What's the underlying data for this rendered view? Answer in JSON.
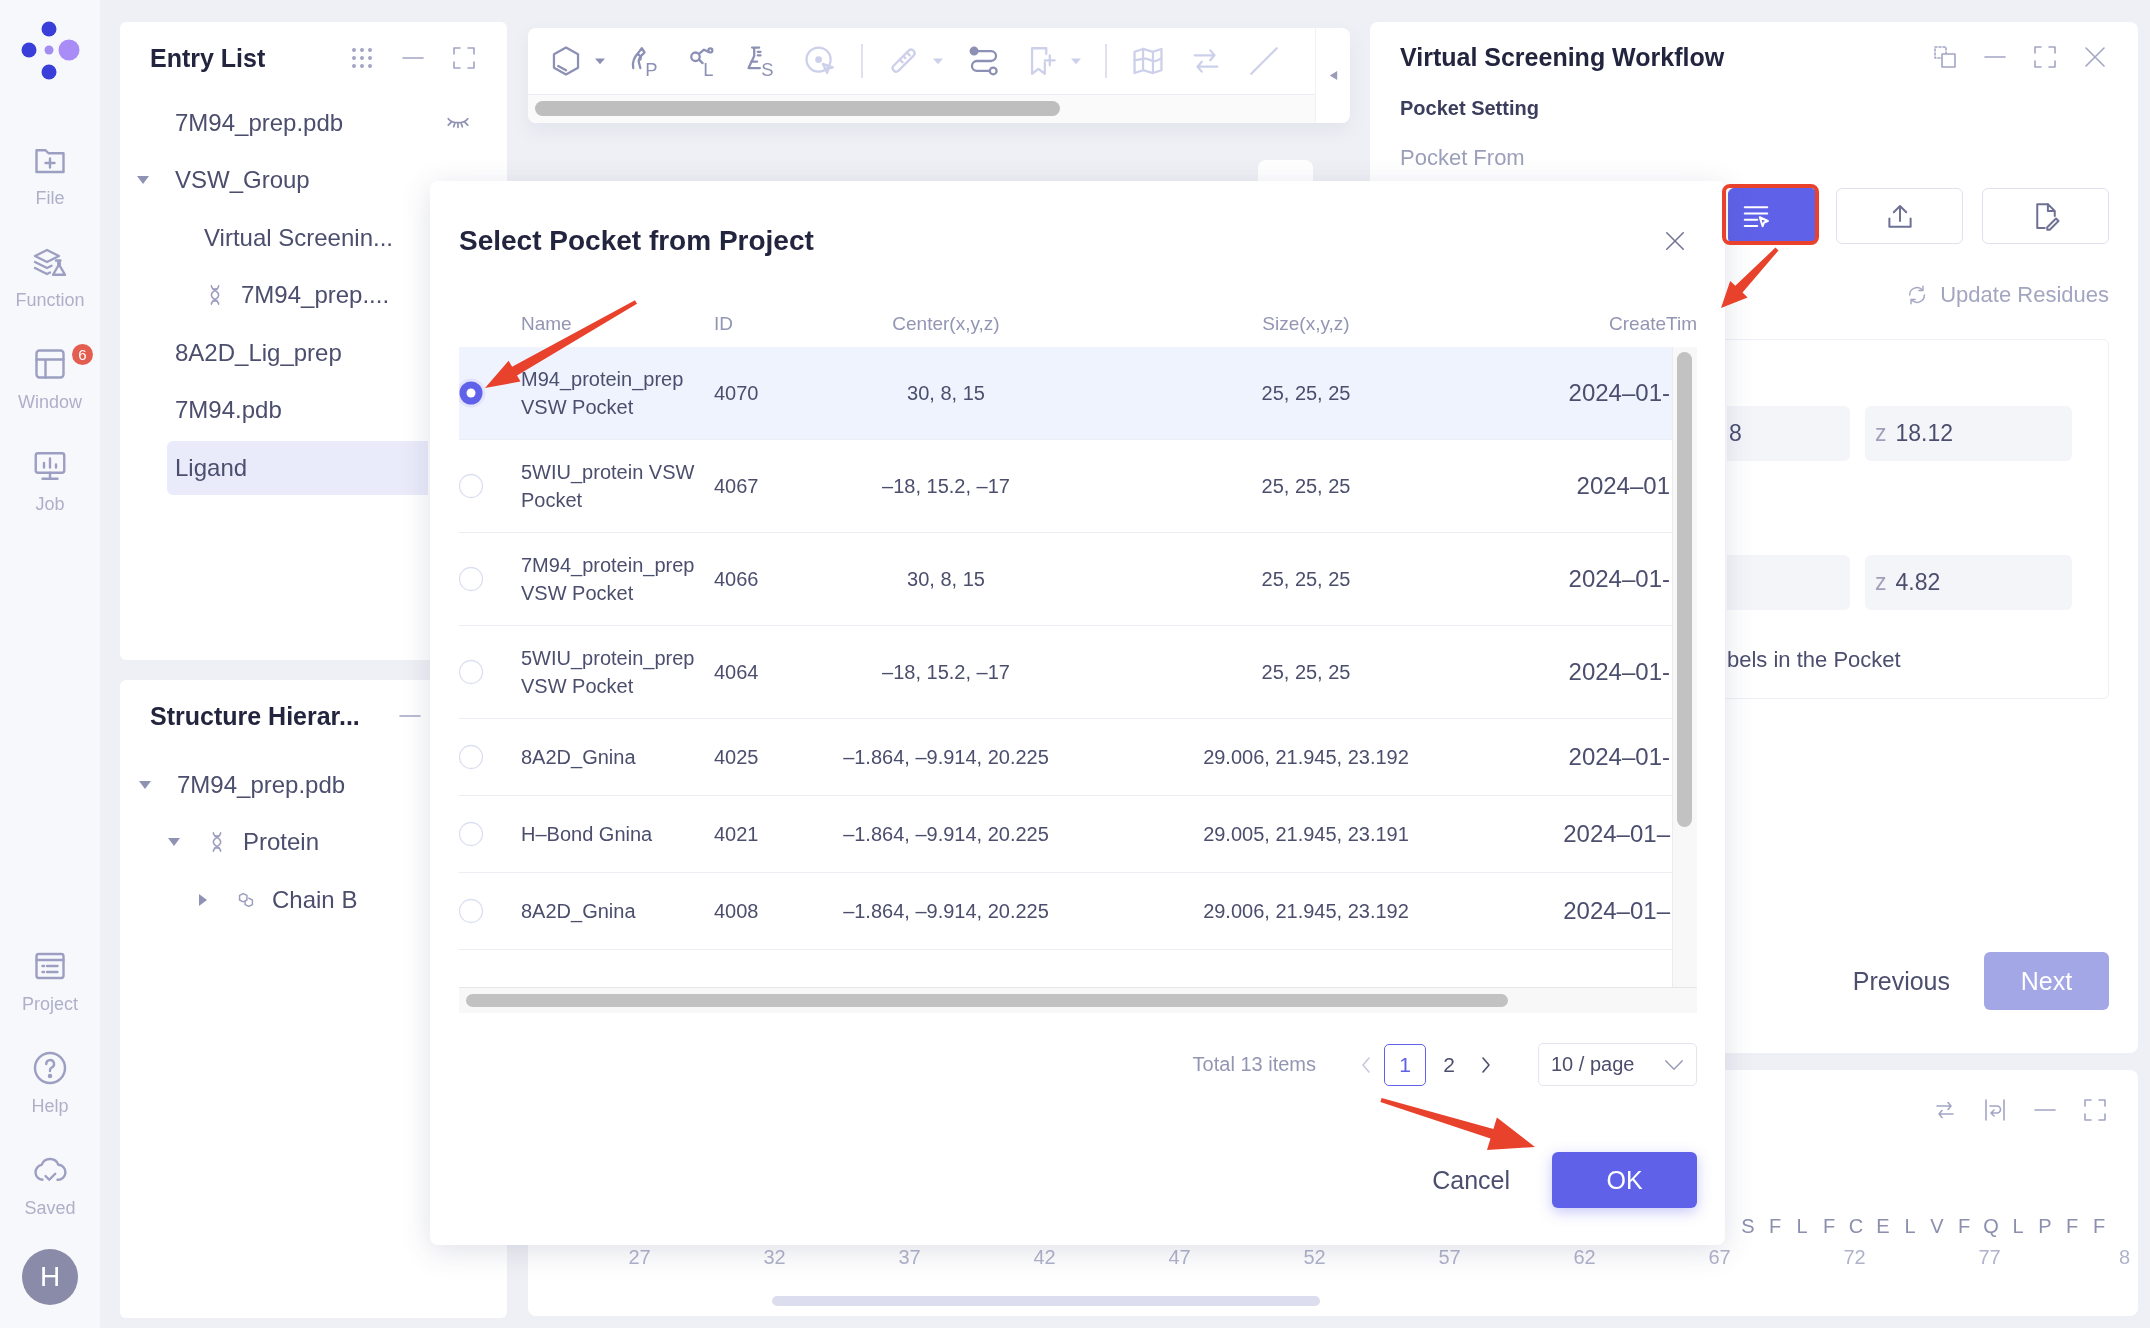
{
  "sidebar": {
    "top_items": [
      {
        "label": "File",
        "kind": "file"
      },
      {
        "label": "Function",
        "kind": "function"
      },
      {
        "label": "Window",
        "kind": "window",
        "badge": "6"
      },
      {
        "label": "Job",
        "kind": "job"
      }
    ],
    "bottom_items": [
      {
        "label": "Project",
        "kind": "project"
      },
      {
        "label": "Help",
        "kind": "help"
      },
      {
        "label": "Saved",
        "kind": "saved"
      }
    ],
    "avatar": {
      "initial": "H"
    }
  },
  "entry_list": {
    "title": "Entry List",
    "items": [
      {
        "label": "7M94_prep.pdb",
        "selected": false,
        "hidden": true
      },
      {
        "label": "VSW_Group",
        "selected": false,
        "expanded": true,
        "children": [
          {
            "label": "Virtual Screenin...",
            "selected": false
          },
          {
            "label": "7M94_prep....",
            "selected": false,
            "kind": "protein"
          }
        ]
      },
      {
        "label": "8A2D_Lig_prep",
        "selected": false
      },
      {
        "label": "7M94.pdb",
        "selected": false
      },
      {
        "label": "Ligand",
        "selected": true
      }
    ]
  },
  "structure_hierarchy": {
    "title": "Structure Hierar...",
    "items": [
      {
        "label": "7M94_prep.pdb",
        "expanded": true,
        "children": [
          {
            "label": "Protein",
            "kind": "protein",
            "expanded": true,
            "children": [
              {
                "label": "Chain B",
                "kind": "chain",
                "expanded": false
              }
            ]
          }
        ]
      }
    ]
  },
  "toolbar": {
    "tools": [
      {
        "kind": "structure",
        "dropdown": true,
        "disabled": false
      },
      {
        "kind": "protein",
        "letter": "P",
        "disabled": false
      },
      {
        "kind": "ligand",
        "letter": "L",
        "disabled": false
      },
      {
        "kind": "lab",
        "letter": "S",
        "disabled": false
      },
      {
        "kind": "pick",
        "disabled": true
      },
      {
        "kind": "separator"
      },
      {
        "kind": "measure",
        "dropdown": true,
        "disabled": true
      },
      {
        "kind": "link",
        "disabled": false
      },
      {
        "kind": "bookmark",
        "dropdown": true,
        "disabled": true
      },
      {
        "kind": "separator"
      },
      {
        "kind": "map",
        "disabled": true
      },
      {
        "kind": "swap",
        "disabled": true
      },
      {
        "kind": "line",
        "disabled": true
      }
    ]
  },
  "workflow": {
    "title": "Virtual Screening Workflow",
    "section": "Pocket Setting",
    "pocket_from": {
      "label": "Pocket From",
      "options": [
        {
          "kind": "list",
          "selected": true
        },
        {
          "kind": "upload",
          "selected": false
        },
        {
          "kind": "edit",
          "selected": false
        }
      ]
    },
    "update_residues": {
      "label": "Update Residues",
      "disabled": true
    },
    "coordinate_rows": [
      {
        "fields": [
          {
            "kind": "coordinate",
            "value": "8"
          },
          {
            "kind": "coordinate",
            "axis": "z",
            "value": "18.12"
          }
        ]
      },
      {
        "fields": [
          {
            "kind": "coordinate"
          },
          {
            "kind": "coordinate",
            "axis": "z",
            "value": "4.82"
          }
        ]
      }
    ],
    "note": "bels in the Pocket",
    "buttons": [
      {
        "label": "Previous",
        "kind": "text",
        "disabled": false
      },
      {
        "label": "Next",
        "kind": "primary",
        "disabled": true
      }
    ]
  },
  "sequence_viewer": {
    "residues": [
      "S",
      "F",
      "L",
      "F",
      "C",
      "E",
      "L",
      "V",
      "F",
      "Q",
      "L",
      "P",
      "F",
      "F"
    ],
    "ruler": [
      "27",
      "32",
      "37",
      "42",
      "47",
      "52",
      "57",
      "62",
      "67",
      "72",
      "77",
      "8"
    ]
  },
  "dialog": {
    "title": "Select Pocket from Project",
    "table": {
      "columns": [
        "Name",
        "ID",
        "Center(x,y,z)",
        "Size(x,y,z)",
        "CreateTim"
      ],
      "rows": [
        {
          "selected": true,
          "name": "M94_protein_prep VSW Pocket",
          "id": "4070",
          "center": "30, 8, 15",
          "size": "25, 25, 25",
          "created": "2024–01-"
        },
        {
          "selected": false,
          "name": "5WIU_protein VSW Pocket",
          "id": "4067",
          "center": "–18, 15.2, –17",
          "size": "25, 25, 25",
          "created": "2024–01"
        },
        {
          "selected": false,
          "name": "7M94_protein_prep VSW Pocket",
          "id": "4066",
          "center": "30, 8, 15",
          "size": "25, 25, 25",
          "created": "2024–01-"
        },
        {
          "selected": false,
          "name": "5WIU_protein_prep VSW Pocket",
          "id": "4064",
          "center": "–18, 15.2, –17",
          "size": "25, 25, 25",
          "created": "2024–01-"
        },
        {
          "selected": false,
          "name": "8A2D_Gnina",
          "id": "4025",
          "center": "–1.864, –9.914, 20.225",
          "size": "29.006, 21.945, 23.192",
          "created": "2024–01-"
        },
        {
          "selected": false,
          "name": "H–Bond Gnina",
          "id": "4021",
          "center": "–1.864, –9.914, 20.225",
          "size": "29.005, 21.945, 23.191",
          "created": "2024–01–"
        },
        {
          "selected": false,
          "name": "8A2D_Gnina",
          "id": "4008",
          "center": "–1.864, –9.914, 20.225",
          "size": "29.006, 21.945, 23.192",
          "created": "2024–01–"
        }
      ]
    },
    "pagination": {
      "total": "Total 13 items",
      "previous": {
        "disabled": true
      },
      "pages": [
        {
          "label": "1",
          "selected": true
        },
        {
          "label": "2",
          "selected": false
        }
      ],
      "next": {
        "disabled": false
      },
      "page_size": "10 / page"
    },
    "buttons": [
      {
        "label": "Cancel",
        "kind": "text"
      },
      {
        "label": "OK",
        "kind": "primary"
      }
    ]
  }
}
